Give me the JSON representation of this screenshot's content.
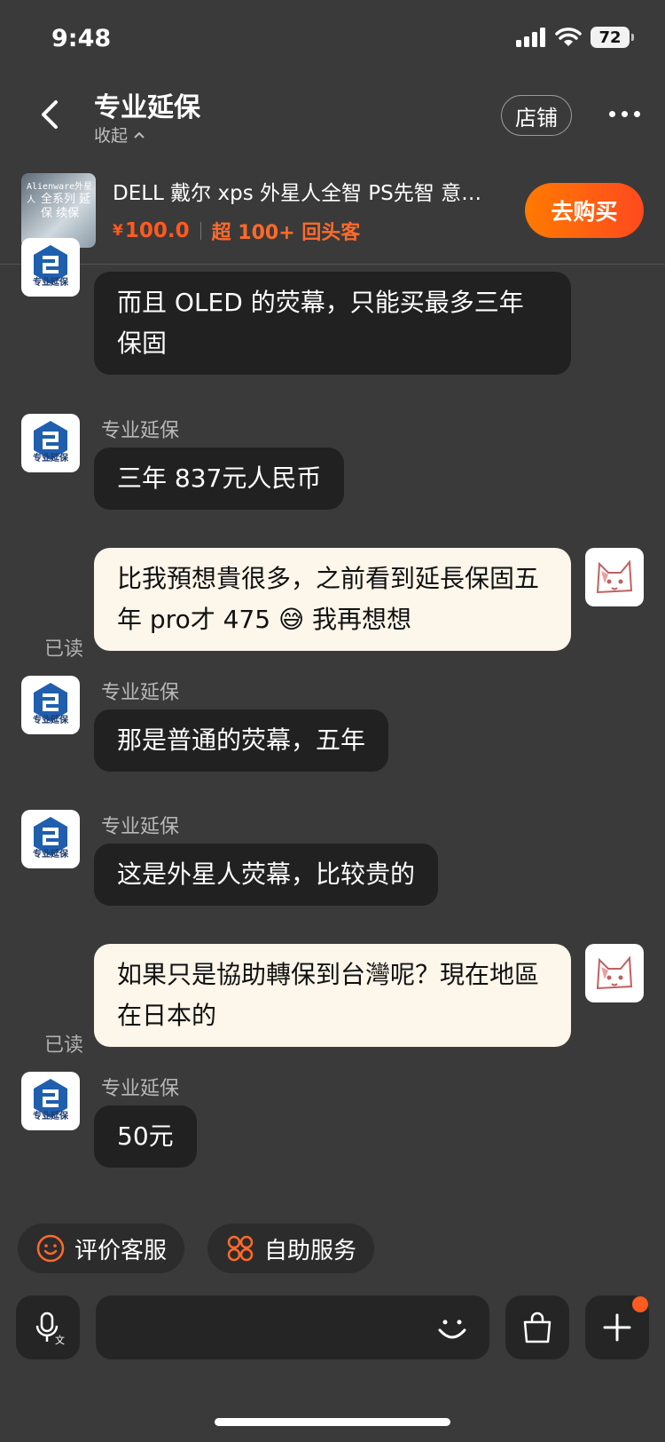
{
  "status_bar": {
    "time": "9:48",
    "battery": "72"
  },
  "header": {
    "title": "专业延保",
    "collapse_label": "收起",
    "shop_button": "店铺"
  },
  "product": {
    "name": "DELL 戴尔 xps 外星人全智 PS先智 意…",
    "currency": "¥",
    "price": "100.0",
    "tag": "超 100+ 回头客",
    "buy_button": "去购买",
    "thumb_line1": "Alienware外星人",
    "thumb_line2": "全系列 延保 续保"
  },
  "messages": [
    {
      "from": "agent",
      "text": "而且 OLED 的荧幕，只能买最多三年保固"
    },
    {
      "from": "agent",
      "sender": "专业延保",
      "text": "三年 837元人民币"
    },
    {
      "from": "user",
      "text": "比我預想貴很多，之前看到延長保固五年 pro才 475 😅 我再想想",
      "read": "已读"
    },
    {
      "from": "agent",
      "sender": "专业延保",
      "text": "那是普通的荧幕，五年"
    },
    {
      "from": "agent",
      "sender": "专业延保",
      "text": "这是外星人荧幕，比较贵的"
    },
    {
      "from": "user",
      "text": "如果只是協助轉保到台灣呢？現在地區在日本的",
      "read": "已读"
    },
    {
      "from": "agent",
      "sender": "专业延保",
      "text": "50元"
    }
  ],
  "agent_logo_text": "专业延保",
  "quick_actions": [
    {
      "label": "评价客服",
      "icon": "smiley-icon"
    },
    {
      "label": "自助服务",
      "icon": "service-grid-icon"
    }
  ],
  "input": {
    "placeholder": ""
  },
  "colors": {
    "accent": "#ff5a1f",
    "background": "#3a3a3a",
    "agent_bubble": "#212121",
    "user_bubble": "#fdf6ea"
  }
}
